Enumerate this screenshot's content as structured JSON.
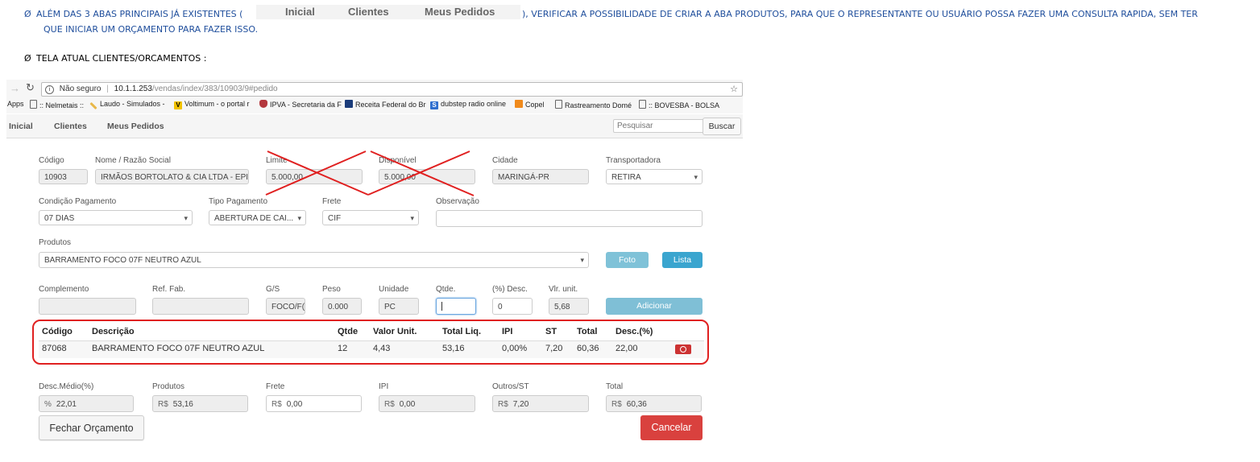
{
  "doc": {
    "bullet_symbol": "Ø",
    "para1_before": "ALÉM DAS 3 ABAS PRINCIPAIS JÁ EXISTENTES (",
    "para1_after": "), VERIFICAR A POSSIBILIDADE DE CRIAR A ABA PRODUTOS, PARA QUE O REPRESENTANTE OU USUÁRIO POSSA FAZER UMA CONSULTA RAPIDA, SEM TER",
    "para1_line2": "QUE INICIAR UM ORÇAMENTO PARA FAZER ISSO.",
    "inline_tabs": [
      "Inicial",
      "Clientes",
      "Meus Pedidos"
    ],
    "heading2": "TELA ATUAL CLIENTES/ORCAMENTOS :"
  },
  "browser": {
    "security": "Não seguro",
    "url_host": "10.1.1.253",
    "url_path": "/vendas/index/383/10903/9#pedido",
    "apps_label": "Apps",
    "bookmarks": [
      {
        "label": ":: Nelmetais ::",
        "icon": "page-icon"
      },
      {
        "label": "Laudo - Simulados -",
        "icon": "pencil-icon"
      },
      {
        "label": "Voltimum - o portal r",
        "icon": "v-icon"
      },
      {
        "label": "IPVA - Secretaria da F",
        "icon": "shield-icon"
      },
      {
        "label": "Receita Federal do Br",
        "icon": "gov-icon"
      },
      {
        "label": "dubstep radio online",
        "icon": "s-icon"
      },
      {
        "label": "Copel",
        "icon": "copel-icon"
      },
      {
        "label": "Rastreamento Domé",
        "icon": "page-icon"
      },
      {
        "label": ":: BOVESBA - BOLSA",
        "icon": "page-icon"
      }
    ]
  },
  "nav": {
    "items": [
      "Inicial",
      "Clientes",
      "Meus Pedidos"
    ],
    "search_placeholder": "Pesquisar",
    "search_button": "Buscar"
  },
  "form": {
    "codigo": {
      "label": "Código",
      "value": "10903"
    },
    "nome": {
      "label": "Nome / Razão Social",
      "value": "IRMÃOS BORTOLATO & CIA LTDA - EPI"
    },
    "limite": {
      "label": "Limite",
      "value": "5.000,00"
    },
    "disponivel": {
      "label": "Disponível",
      "value": "5.000,00"
    },
    "cidade": {
      "label": "Cidade",
      "value": "MARINGÁ-PR"
    },
    "transportadora": {
      "label": "Transportadora",
      "value": "RETIRA"
    },
    "condicao": {
      "label": "Condição Pagamento",
      "value": "07 DIAS"
    },
    "tipo": {
      "label": "Tipo Pagamento",
      "value": "ABERTURA DE CAI..."
    },
    "frete_sel": {
      "label": "Frete",
      "value": "CIF"
    },
    "observacao": {
      "label": "Observação",
      "value": ""
    },
    "produtos": {
      "label": "Produtos",
      "value": "BARRAMENTO FOCO 07F NEUTRO AZUL"
    },
    "foto_button": "Foto",
    "lista_button": "Lista",
    "complemento": {
      "label": "Complemento",
      "value": ""
    },
    "ref_fab": {
      "label": "Ref. Fab.",
      "value": ""
    },
    "gs": {
      "label": "G/S",
      "value": "FOCO/F("
    },
    "peso": {
      "label": "Peso",
      "value": "0.000"
    },
    "unidade": {
      "label": "Unidade",
      "value": "PC"
    },
    "qtde": {
      "label": "Qtde.",
      "value": ""
    },
    "desc": {
      "label": "(%) Desc.",
      "value": "0"
    },
    "vlr_unit": {
      "label": "Vlr. unit.",
      "value": "5,68"
    },
    "adicionar_button": "Adicionar"
  },
  "table": {
    "headers": [
      "Código",
      "Descrição",
      "Qtde",
      "Valor Unit.",
      "Total Liq.",
      "IPI",
      "ST",
      "Total",
      "Desc.(%)"
    ],
    "rows": [
      [
        "87068",
        "BARRAMENTO FOCO 07F NEUTRO AZUL",
        "12",
        "4,43",
        "53,16",
        "0,00%",
        "7,20",
        "60,36",
        "22,00"
      ]
    ]
  },
  "totals": {
    "desc_medio": {
      "label": "Desc.Médio(%)",
      "prefix": "%",
      "value": "22,01"
    },
    "produtos": {
      "label": "Produtos",
      "prefix": "R$",
      "value": "53,16"
    },
    "frete": {
      "label": "Frete",
      "prefix": "R$",
      "value": "0,00"
    },
    "ipi": {
      "label": "IPI",
      "prefix": "R$",
      "value": "0,00"
    },
    "outros": {
      "label": "Outros/ST",
      "prefix": "R$",
      "value": "7,20"
    },
    "total": {
      "label": "Total",
      "prefix": "R$",
      "value": "60,36"
    }
  },
  "actions": {
    "fechar": "Fechar Orçamento",
    "cancelar": "Cancelar"
  },
  "colors": {
    "doc_text": "#1f4e9c",
    "annotation_red": "#e02020",
    "foto_button": "#7fc2d8",
    "lista_button": "#3aa5cf",
    "adicionar_button": "#7fbfd6",
    "cancel_button": "#d9413e",
    "remove_button": "#cc3333"
  }
}
